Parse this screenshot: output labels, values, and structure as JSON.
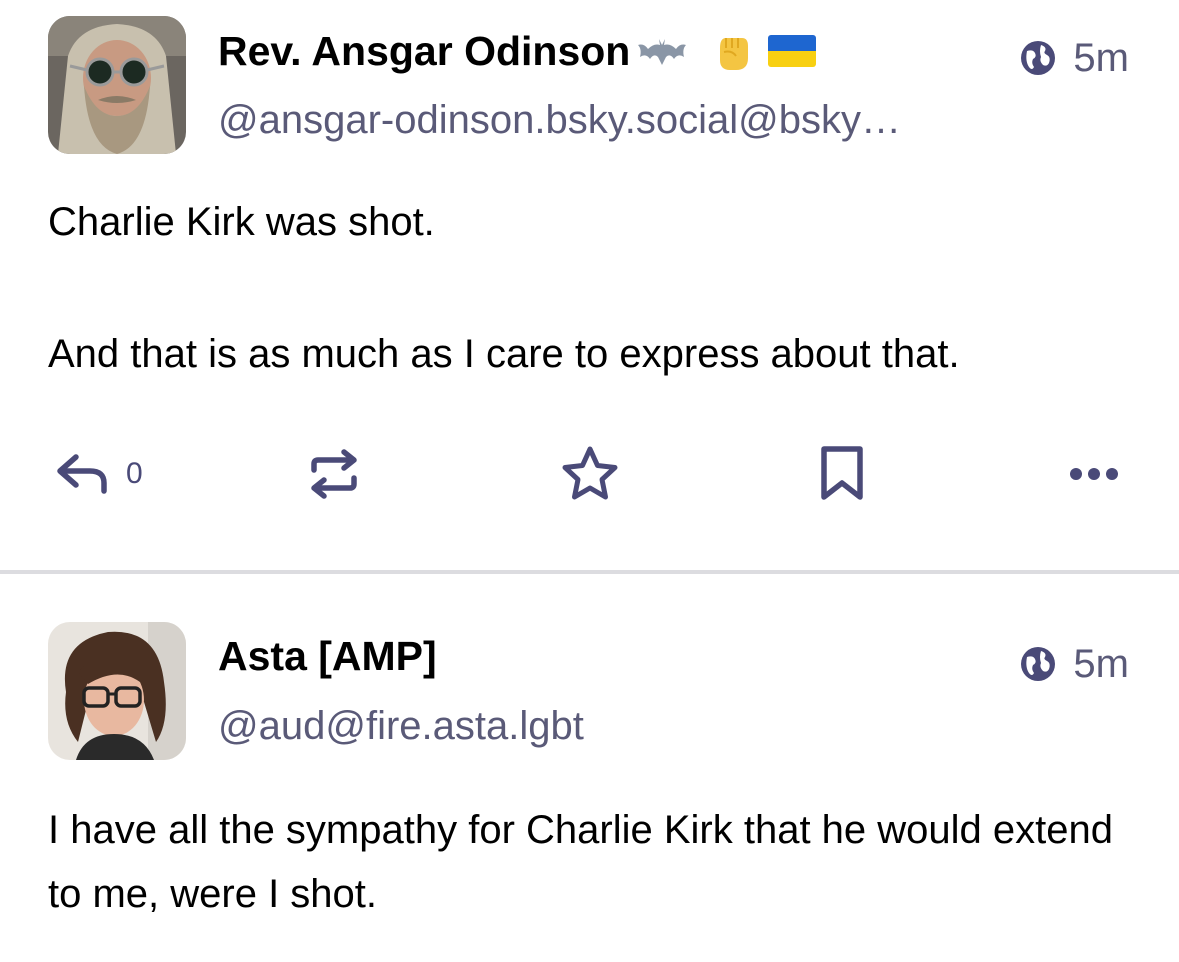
{
  "colors": {
    "text": "#000000",
    "muted": "#5a5a78",
    "icon": "#4a4a78",
    "divider": "#dcdce0"
  },
  "posts": [
    {
      "display_name": "Rev. Ansgar Odinson",
      "name_emojis": [
        "bat-icon",
        "raised-fist-icon",
        "ukraine-flag-icon"
      ],
      "handle": "@ansgar-odinson.bsky.social@bsky…",
      "visibility_icon": "globe-icon",
      "time": "5m",
      "content": [
        "Charlie Kirk was shot.",
        "And that is as much as I care to express about that."
      ],
      "actions": {
        "reply_count": "0"
      }
    },
    {
      "display_name": "Asta [AMP]",
      "handle": "@aud@fire.asta.lgbt",
      "visibility_icon": "globe-icon",
      "time": "5m",
      "content": [
        "I have all the sympathy for Charlie Kirk that he would extend to me, were I shot."
      ]
    }
  ]
}
